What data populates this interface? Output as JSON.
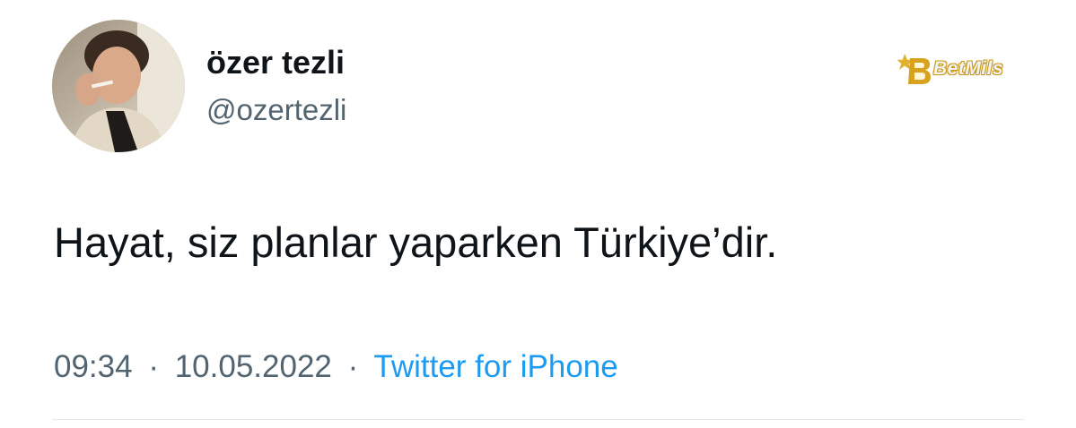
{
  "tweet": {
    "author": {
      "display_name": "özer tezli",
      "handle": "@ozertezli",
      "avatar_icon": "profile-photo"
    },
    "text": "Hayat, siz planlar yaparken Türkiye’dir.",
    "time": "09:34",
    "separator": "·",
    "date": "10.05.2022",
    "source": "Twitter for iPhone"
  },
  "watermark": {
    "text": "BetMils",
    "icon": "betmils-logo",
    "color": "#d9a520"
  },
  "colors": {
    "name": "#0f1419",
    "secondary": "#536471",
    "link": "#1d9bf0",
    "divider": "#e6e9ea"
  }
}
